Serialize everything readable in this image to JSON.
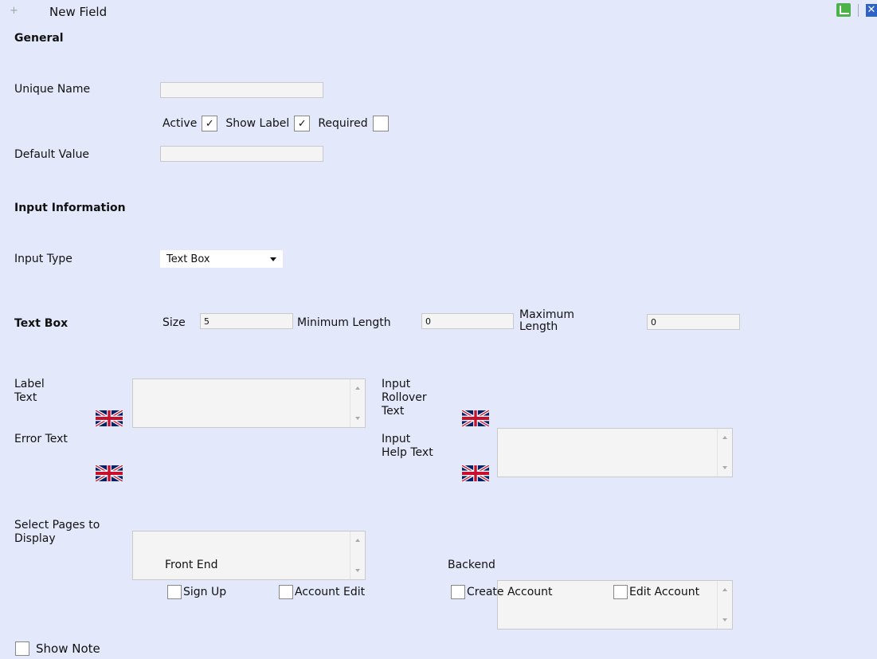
{
  "header": {
    "title": "New Field",
    "plus": "+"
  },
  "general": {
    "heading": "General",
    "unique_name_label": "Unique Name",
    "unique_name_value": "",
    "active_label": "Active",
    "active_checked": true,
    "show_label_label": "Show Label",
    "show_label_checked": true,
    "required_label": "Required",
    "required_checked": false,
    "default_value_label": "Default Value",
    "default_value_value": ""
  },
  "input_info": {
    "heading": "Input Information",
    "input_type_label": "Input Type",
    "input_type_value": "Text Box"
  },
  "text_box": {
    "heading": "Text Box",
    "size_label": "Size",
    "size_value": "5",
    "min_label": "Minimum Length",
    "min_value": "0",
    "max_label_line1": "Maximum",
    "max_label_line2": "Length",
    "max_value": "0"
  },
  "texts": {
    "label_text_line1": "Label",
    "label_text_line2": "Text",
    "rollover_line1": "Input",
    "rollover_line2": "Rollover",
    "rollover_line3": "Text",
    "error_text": "Error Text",
    "help_line1": "Input",
    "help_line2": "Help Text"
  },
  "pages": {
    "heading_line1": "Select Pages to",
    "heading_line2": "Display",
    "front_end": "Front End",
    "backend": "Backend",
    "sign_up": "Sign Up",
    "account_edit": "Account Edit",
    "create_account": "Create Account",
    "edit_account": "Edit Account"
  },
  "show_note": "Show Note",
  "colors": {
    "background": "#e3e9fb",
    "edit_icon": "#4cb348",
    "close_icon": "#2d63c7"
  }
}
